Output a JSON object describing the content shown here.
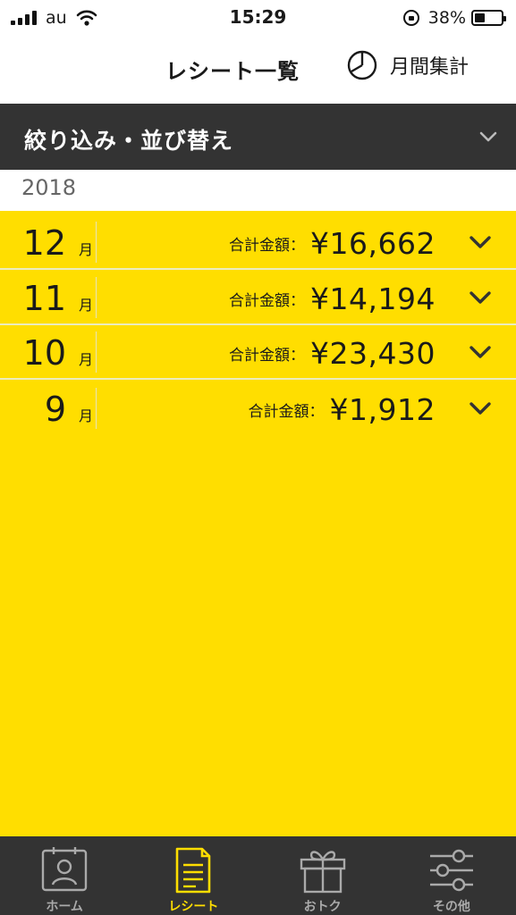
{
  "status_bar": {
    "carrier": "au",
    "time": "15:29",
    "battery_percent": "38%",
    "battery_level": 0.38
  },
  "header": {
    "title": "レシート一覧",
    "monthly_summary_label": "月間集計",
    "monthly_summary_icon": "pie-chart-icon"
  },
  "filter": {
    "label": "絞り込み・並び替え",
    "icon": "chevron-down-icon"
  },
  "year": "2018",
  "months": [
    {
      "month": "12",
      "unit": "月",
      "total_label": "合計金額：",
      "total": "¥16,662"
    },
    {
      "month": "11",
      "unit": "月",
      "total_label": "合計金額：",
      "total": "¥14,194"
    },
    {
      "month": "10",
      "unit": "月",
      "total_label": "合計金額：",
      "total": "¥23,430"
    },
    {
      "month": "9",
      "unit": "月",
      "total_label": "合計金額：",
      "total": "¥1,912"
    }
  ],
  "tabs": [
    {
      "label": "ホーム",
      "icon": "home-person-icon",
      "active": false
    },
    {
      "label": "レシート",
      "icon": "receipt-icon",
      "active": true
    },
    {
      "label": "おトク",
      "icon": "gift-icon",
      "active": false
    },
    {
      "label": "その他",
      "icon": "sliders-icon",
      "active": false
    }
  ],
  "colors": {
    "accent_yellow": "#ffde00",
    "dark_bar": "#333333",
    "tab_inactive": "#aaaaaa"
  }
}
